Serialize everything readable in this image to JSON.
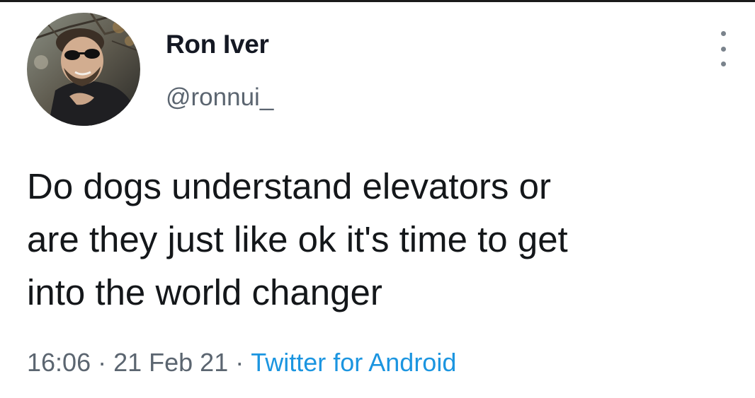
{
  "user": {
    "display_name": "Ron Iver",
    "handle": "@ronnui_"
  },
  "tweet": {
    "text_lines": [
      "Do dogs understand elevators or",
      "are they just like ok it's time to get",
      "into the world changer"
    ],
    "time": "16:06",
    "date": "21 Feb 21",
    "separator": "·",
    "source": "Twitter for Android"
  },
  "icons": {
    "more": "more-vertical-icon",
    "avatar": "avatar"
  },
  "colors": {
    "text": "#14171a",
    "secondary": "#5b6570",
    "link": "#1b95e0"
  }
}
